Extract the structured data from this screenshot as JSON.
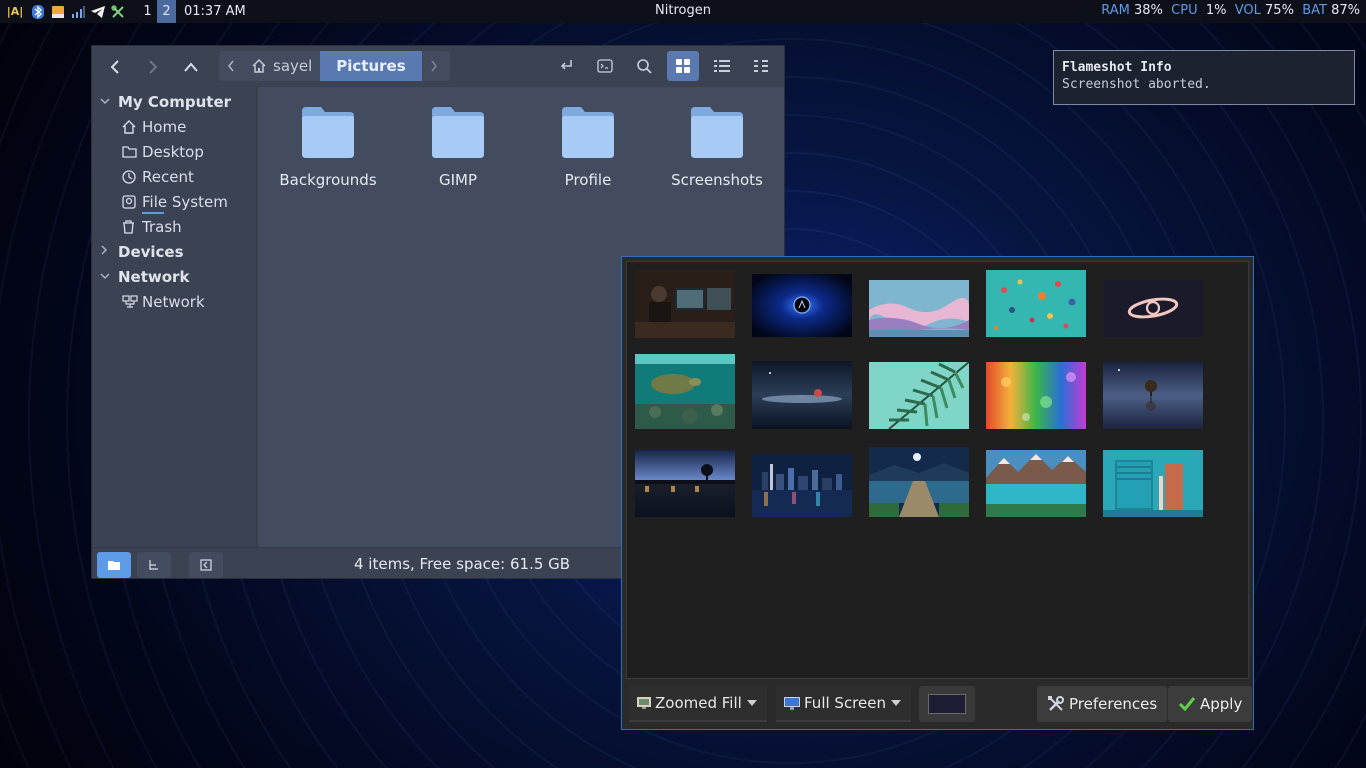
{
  "topbar": {
    "keyboard_label": "A",
    "workspaces": [
      "1",
      "2"
    ],
    "active_workspace": "2",
    "clock": "01:37 AM",
    "window_title": "Nitrogen",
    "stats": [
      {
        "label": "RAM",
        "value": "38%"
      },
      {
        "label": "CPU",
        "value": "1%"
      },
      {
        "label": "VOL",
        "value": "75%"
      },
      {
        "label": "BAT",
        "value": "87%"
      }
    ]
  },
  "file_manager": {
    "breadcrumb_home": "sayel",
    "breadcrumb_current": "Pictures",
    "sidebar": {
      "sections": [
        {
          "label": "My Computer",
          "expanded": true
        },
        {
          "label": "Devices",
          "expanded": false
        },
        {
          "label": "Network",
          "expanded": true
        }
      ],
      "my_computer_items": [
        {
          "label": "Home",
          "icon": "home-icon"
        },
        {
          "label": "Desktop",
          "icon": "folder-icon"
        },
        {
          "label": "Recent",
          "icon": "clock-icon"
        },
        {
          "label": "File System",
          "icon": "drive-icon"
        },
        {
          "label": "Trash",
          "icon": "trash-icon"
        }
      ],
      "network_items": [
        {
          "label": "Network",
          "icon": "network-icon"
        }
      ]
    },
    "folders": [
      "Backgrounds",
      "GIMP",
      "Profile",
      "Screenshots"
    ],
    "status": "4 items, Free space: 61.5 GB"
  },
  "notification": {
    "title": "Flameshot Info",
    "body": "Screenshot aborted."
  },
  "nitrogen": {
    "zoom_mode": "Zoomed Fill",
    "screen": "Full Screen",
    "bg_color": "#1e1d33",
    "preferences_label": "Preferences",
    "apply_label": "Apply"
  },
  "colors": {
    "accent": "#5a79b0",
    "folder": "#9ec3f0",
    "topbar_label": "#5e9be6"
  }
}
